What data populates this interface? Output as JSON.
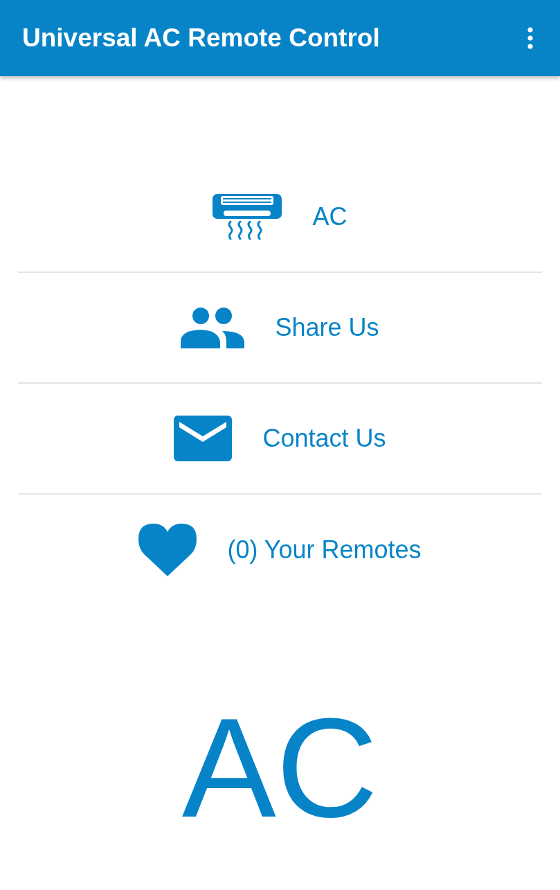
{
  "app_bar": {
    "title": "Universal AC Remote Control"
  },
  "menu_items": [
    {
      "kind": "ac",
      "label": "AC"
    },
    {
      "kind": "share",
      "label": "Share Us"
    },
    {
      "kind": "contact",
      "label": "Contact Us"
    },
    {
      "kind": "favorites",
      "label": "(0) Your Remotes"
    }
  ],
  "logo": {
    "text": "AC"
  }
}
